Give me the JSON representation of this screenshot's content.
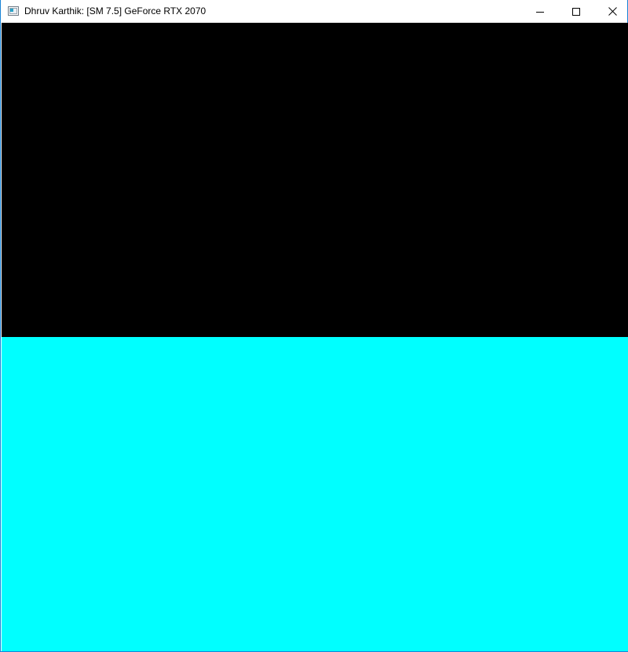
{
  "window": {
    "title": "Dhruv Karthik: [SM 7.5] GeForce RTX 2070",
    "app_icon": "window-app-icon",
    "controls": {
      "minimize_icon": "minimize-icon",
      "maximize_icon": "maximize-icon",
      "close_icon": "close-icon"
    },
    "border_color": "#1883d7"
  },
  "canvas": {
    "top_color": "#000000",
    "bottom_color": "#00ffff"
  }
}
